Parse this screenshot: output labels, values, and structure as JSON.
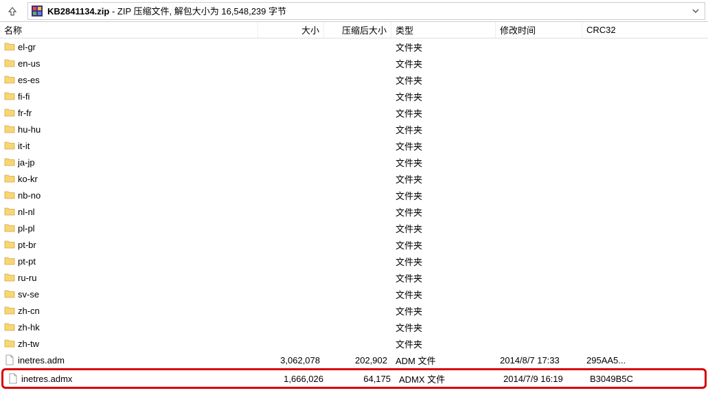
{
  "toolbar": {
    "archive_name": "KB2841134.zip",
    "archive_desc": " - ZIP 压缩文件, 解包大小为 16,548,239 字节"
  },
  "columns": {
    "name": "名称",
    "size": "大小",
    "packed": "压缩后大小",
    "type": "类型",
    "date": "修改时间",
    "crc": "CRC32"
  },
  "types": {
    "folder": "文件夹",
    "adm": "ADM 文件",
    "admx": "ADMX 文件"
  },
  "folders": [
    "el-gr",
    "en-us",
    "es-es",
    "fi-fi",
    "fr-fr",
    "hu-hu",
    "it-it",
    "ja-jp",
    "ko-kr",
    "nb-no",
    "nl-nl",
    "pl-pl",
    "pt-br",
    "pt-pt",
    "ru-ru",
    "sv-se",
    "zh-cn",
    "zh-hk",
    "zh-tw"
  ],
  "files": [
    {
      "name": "inetres.adm",
      "size": "3,062,078",
      "packed": "202,902",
      "type_key": "adm",
      "date": "2014/8/7 17:33",
      "crc": "295AA5..."
    },
    {
      "name": "inetres.admx",
      "size": "1,666,026",
      "packed": "64,175",
      "type_key": "admx",
      "date": "2014/7/9 16:19",
      "crc": "B3049B5C"
    }
  ]
}
